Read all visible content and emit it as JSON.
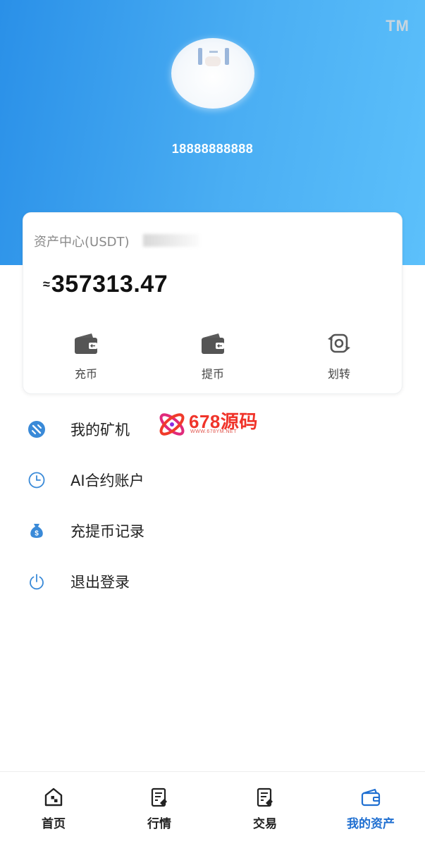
{
  "header": {
    "tm_mark": "TM",
    "avatar_icon": "avatar-icon",
    "phone": "18888888888"
  },
  "asset_card": {
    "title": "资产中心(USDT)",
    "approx_symbol": "≈",
    "balance": "357313.47",
    "actions": [
      {
        "label": "充币",
        "icon": "wallet-icon"
      },
      {
        "label": "提币",
        "icon": "wallet-icon"
      },
      {
        "label": "划转",
        "icon": "transfer-icon"
      }
    ]
  },
  "menu": {
    "items": [
      {
        "label": "我的矿机",
        "icon": "mining-icon"
      },
      {
        "label": "AI合约账户",
        "icon": "clock-icon"
      },
      {
        "label": "充提币记录",
        "icon": "money-bag-icon"
      },
      {
        "label": "退出登录",
        "icon": "power-icon"
      }
    ]
  },
  "watermark": {
    "text": "678源码",
    "sub": "WWW.678YM.NET"
  },
  "tabbar": {
    "tabs": [
      {
        "label": "首页",
        "icon": "home-icon"
      },
      {
        "label": "行情",
        "icon": "market-icon"
      },
      {
        "label": "交易",
        "icon": "trade-icon"
      },
      {
        "label": "我的资产",
        "icon": "wallet-icon",
        "active": true
      }
    ]
  },
  "colors": {
    "header_gradient_start": "#2a90e8",
    "header_gradient_end": "#5cc0fb",
    "active_tab": "#1f6fd1",
    "menu_icon": "#3a8ad8",
    "watermark": "#f0342a"
  }
}
